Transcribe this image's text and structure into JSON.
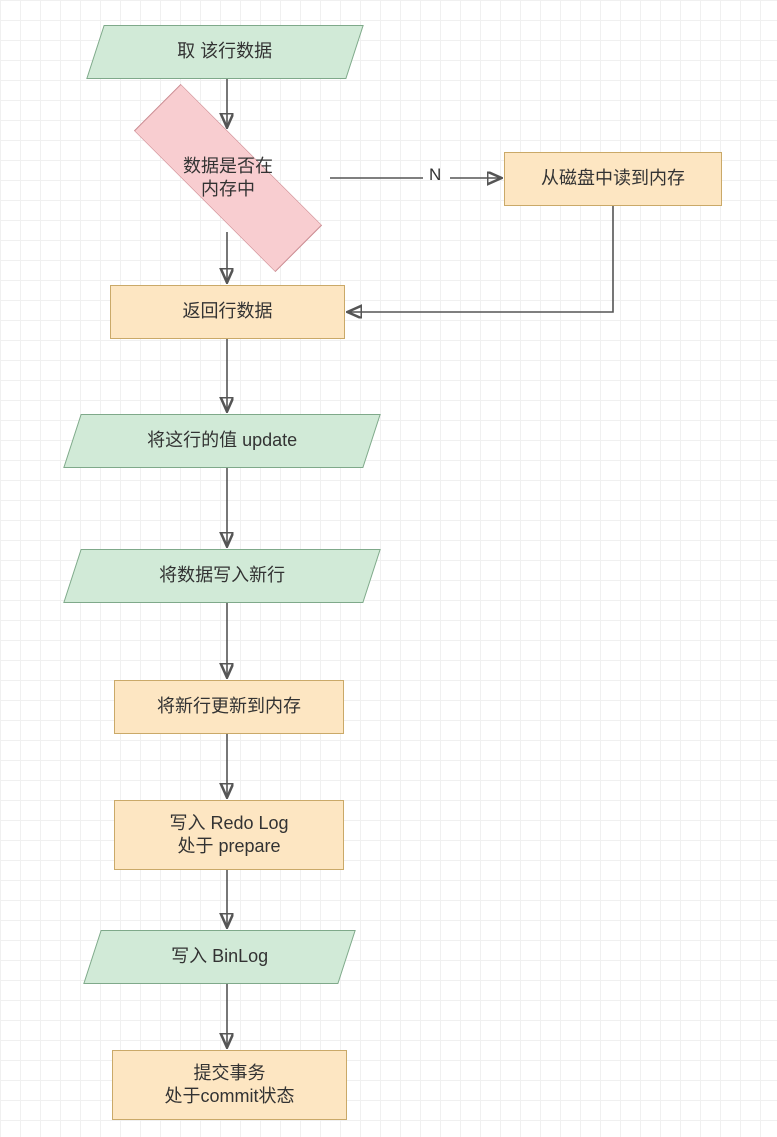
{
  "nodes": {
    "n1": "取 该行数据",
    "n2": "数据是否在\n内存中",
    "n3": "从磁盘中读到内存",
    "n4": "返回行数据",
    "n5": "将这行的值 update",
    "n6": "将数据写入新行",
    "n7": "将新行更新到内存",
    "n8": "写入 Redo Log\n处于 prepare",
    "n9": "写入 BinLog",
    "n10": "提交事务\n处于commit状态"
  },
  "labels": {
    "no": "N"
  },
  "colors": {
    "green_fill": "#d1ead7",
    "green_border": "#7fa98a",
    "orange_fill": "#fde6c2",
    "orange_border": "#caa968",
    "pink_fill": "#f8cdd0",
    "pink_border": "#c98a90",
    "arrow": "#555555"
  }
}
